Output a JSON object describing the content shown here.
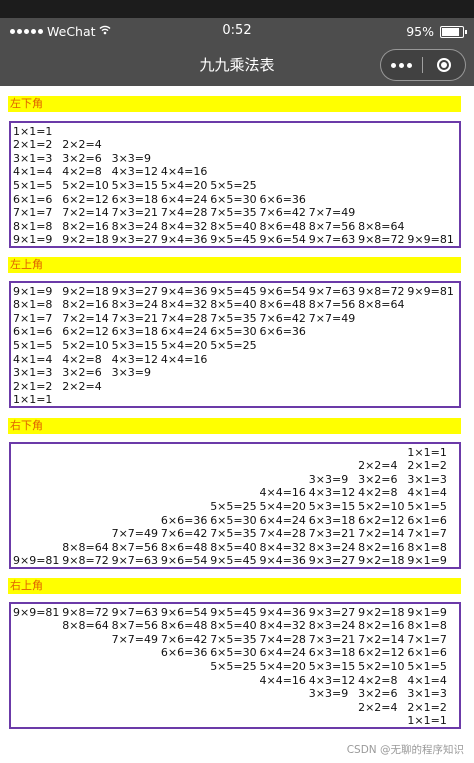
{
  "status_bar": {
    "carrier": "WeChat",
    "time": "0:52",
    "battery_percent": "95%",
    "battery_level": 0.95,
    "icons": [
      "signal-dots-icon",
      "wifi-icon",
      "battery-icon"
    ]
  },
  "nav": {
    "title": "九九乘法表",
    "capsule_icons": [
      "more-icon",
      "close-mini-program-icon"
    ]
  },
  "sections": [
    {
      "label": "左下角"
    },
    {
      "label": "左上角"
    },
    {
      "label": "右下角"
    },
    {
      "label": "右上角"
    }
  ],
  "tables": {
    "bottom_left": [
      [
        "1×1=1"
      ],
      [
        "2×1=2",
        "2×2=4"
      ],
      [
        "3×1=3",
        "3×2=6",
        "3×3=9"
      ],
      [
        "4×1=4",
        "4×2=8",
        "4×3=12",
        "4×4=16"
      ],
      [
        "5×1=5",
        "5×2=10",
        "5×3=15",
        "5×4=20",
        "5×5=25"
      ],
      [
        "6×1=6",
        "6×2=12",
        "6×3=18",
        "6×4=24",
        "6×5=30",
        "6×6=36"
      ],
      [
        "7×1=7",
        "7×2=14",
        "7×3=21",
        "7×4=28",
        "7×5=35",
        "7×6=42",
        "7×7=49"
      ],
      [
        "8×1=8",
        "8×2=16",
        "8×3=24",
        "8×4=32",
        "8×5=40",
        "8×6=48",
        "8×7=56",
        "8×8=64"
      ],
      [
        "9×1=9",
        "9×2=18",
        "9×3=27",
        "9×4=36",
        "9×5=45",
        "9×6=54",
        "9×7=63",
        "9×8=72",
        "9×9=81"
      ]
    ],
    "top_left": [
      [
        "9×1=9",
        "9×2=18",
        "9×3=27",
        "9×4=36",
        "9×5=45",
        "9×6=54",
        "9×7=63",
        "9×8=72",
        "9×9=81"
      ],
      [
        "8×1=8",
        "8×2=16",
        "8×3=24",
        "8×4=32",
        "8×5=40",
        "8×6=48",
        "8×7=56",
        "8×8=64"
      ],
      [
        "7×1=7",
        "7×2=14",
        "7×3=21",
        "7×4=28",
        "7×5=35",
        "7×6=42",
        "7×7=49"
      ],
      [
        "6×1=6",
        "6×2=12",
        "6×3=18",
        "6×4=24",
        "6×5=30",
        "6×6=36"
      ],
      [
        "5×1=5",
        "5×2=10",
        "5×3=15",
        "5×4=20",
        "5×5=25"
      ],
      [
        "4×1=4",
        "4×2=8",
        "4×3=12",
        "4×4=16"
      ],
      [
        "3×1=3",
        "3×2=6",
        "3×3=9"
      ],
      [
        "2×1=2",
        "2×2=4"
      ],
      [
        "1×1=1"
      ]
    ],
    "bottom_right": [
      [
        "1×1=1"
      ],
      [
        "2×2=4",
        "2×1=2"
      ],
      [
        "3×3=9",
        "3×2=6",
        "3×1=3"
      ],
      [
        "4×4=16",
        "4×3=12",
        "4×2=8",
        "4×1=4"
      ],
      [
        "5×5=25",
        "5×4=20",
        "5×3=15",
        "5×2=10",
        "5×1=5"
      ],
      [
        "6×6=36",
        "6×5=30",
        "6×4=24",
        "6×3=18",
        "6×2=12",
        "6×1=6"
      ],
      [
        "7×7=49",
        "7×6=42",
        "7×5=35",
        "7×4=28",
        "7×3=21",
        "7×2=14",
        "7×1=7"
      ],
      [
        "8×8=64",
        "8×7=56",
        "8×6=48",
        "8×5=40",
        "8×4=32",
        "8×3=24",
        "8×2=16",
        "8×1=8"
      ],
      [
        "9×9=81",
        "9×8=72",
        "9×7=63",
        "9×6=54",
        "9×5=45",
        "9×4=36",
        "9×3=27",
        "9×2=18",
        "9×1=9"
      ]
    ],
    "top_right": [
      [
        "9×9=81",
        "9×8=72",
        "9×7=63",
        "9×6=54",
        "9×5=45",
        "9×4=36",
        "9×3=27",
        "9×2=18",
        "9×1=9"
      ],
      [
        "8×8=64",
        "8×7=56",
        "8×6=48",
        "8×5=40",
        "8×4=32",
        "8×3=24",
        "8×2=16",
        "8×1=8"
      ],
      [
        "7×7=49",
        "7×6=42",
        "7×5=35",
        "7×4=28",
        "7×3=21",
        "7×2=14",
        "7×1=7"
      ],
      [
        "6×6=36",
        "6×5=30",
        "6×4=24",
        "6×3=18",
        "6×2=12",
        "6×1=6"
      ],
      [
        "5×5=25",
        "5×4=20",
        "5×3=15",
        "5×2=10",
        "5×1=5"
      ],
      [
        "4×4=16",
        "4×3=12",
        "4×2=8",
        "4×1=4"
      ],
      [
        "3×3=9",
        "3×2=6",
        "3×1=3"
      ],
      [
        "2×2=4",
        "2×1=2"
      ],
      [
        "1×1=1"
      ]
    ]
  },
  "watermark": "CSDN @无聊的程序知识"
}
